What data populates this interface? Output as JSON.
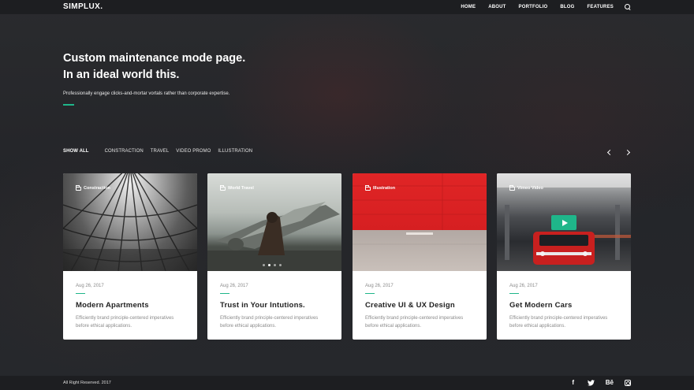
{
  "brand": {
    "logo": "SIMPLUX."
  },
  "nav": {
    "items": [
      "HOME",
      "ABOUT",
      "PORTFOLIO",
      "BLOG",
      "FEATURES"
    ],
    "search_icon": "search-icon"
  },
  "hero": {
    "title_line1": "Custom maintenance mode page.",
    "title_line2": "In an ideal world this.",
    "subtitle": "Professionally engage clicks-and-mortar vortals rather than corporate expertise."
  },
  "filters": {
    "items": [
      "SHOW ALL",
      "CONSTRACTION",
      "TRAVEL",
      "VIDEO PROMO",
      "ILLUSTRATION"
    ],
    "active": "SHOW ALL"
  },
  "cards": [
    {
      "category": "Constraction",
      "date": "Aug 26, 2017",
      "title": "Modern Apartments",
      "text_line1": "Efficiently brand principle-centered imperatives",
      "text_line2": "before ethical applications."
    },
    {
      "category": "World Travel",
      "date": "Aug 26, 2017",
      "title": "Trust in Your Intutions.",
      "text_line1": "Efficiently brand principle-centered imperatives",
      "text_line2": "before ethical applications."
    },
    {
      "category": "Illustration",
      "date": "Aug 26, 2017",
      "title": "Creative UI & UX Design",
      "text_line1": "Efficiently brand principle-centered imperatives",
      "text_line2": "before ethical applications."
    },
    {
      "category": "Vimeo Video",
      "date": "Aug 26, 2017",
      "title": "Get Modern Cars",
      "text_line1": "Efficiently brand principle-centered imperatives",
      "text_line2": "before ethical applications."
    }
  ],
  "footer": {
    "copyright": "All Right Reserved. 2017",
    "social": {
      "facebook": "f",
      "behance": "Bē"
    }
  },
  "colors": {
    "accent": "#1fb68a",
    "topbar": "#1d1e21",
    "background": "#25272b"
  }
}
